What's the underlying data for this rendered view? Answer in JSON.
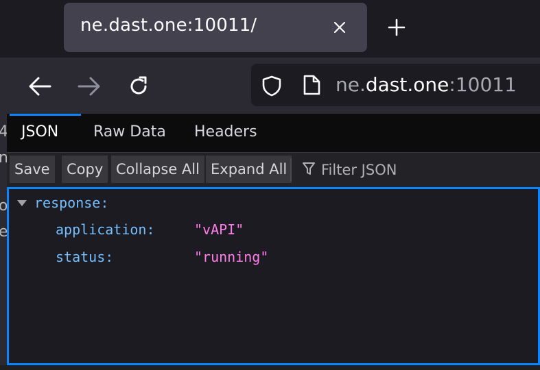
{
  "tab": {
    "title": "ne.dast.one:10011/"
  },
  "urlbar": {
    "prefix": "ne.",
    "domain": "dast.one",
    "suffix": ":10011"
  },
  "viewer_tabs": [
    {
      "label": "JSON",
      "active": true
    },
    {
      "label": "Raw Data",
      "active": false
    },
    {
      "label": "Headers",
      "active": false
    }
  ],
  "toolbar": {
    "save": "Save",
    "copy": "Copy",
    "collapse_all": "Collapse All",
    "expand_all": "Expand All",
    "filter_placeholder": "Filter JSON"
  },
  "json": {
    "root_key": "response:",
    "rows": [
      {
        "key": "application:",
        "value": "\"vAPI\""
      },
      {
        "key": "status:",
        "value": "\"running\""
      }
    ]
  },
  "background_fragments": [
    "4",
    "n",
    "o",
    "e"
  ],
  "colors": {
    "accent": "#0a84ff",
    "key": "#75bfff",
    "string": "#ff7de9"
  }
}
